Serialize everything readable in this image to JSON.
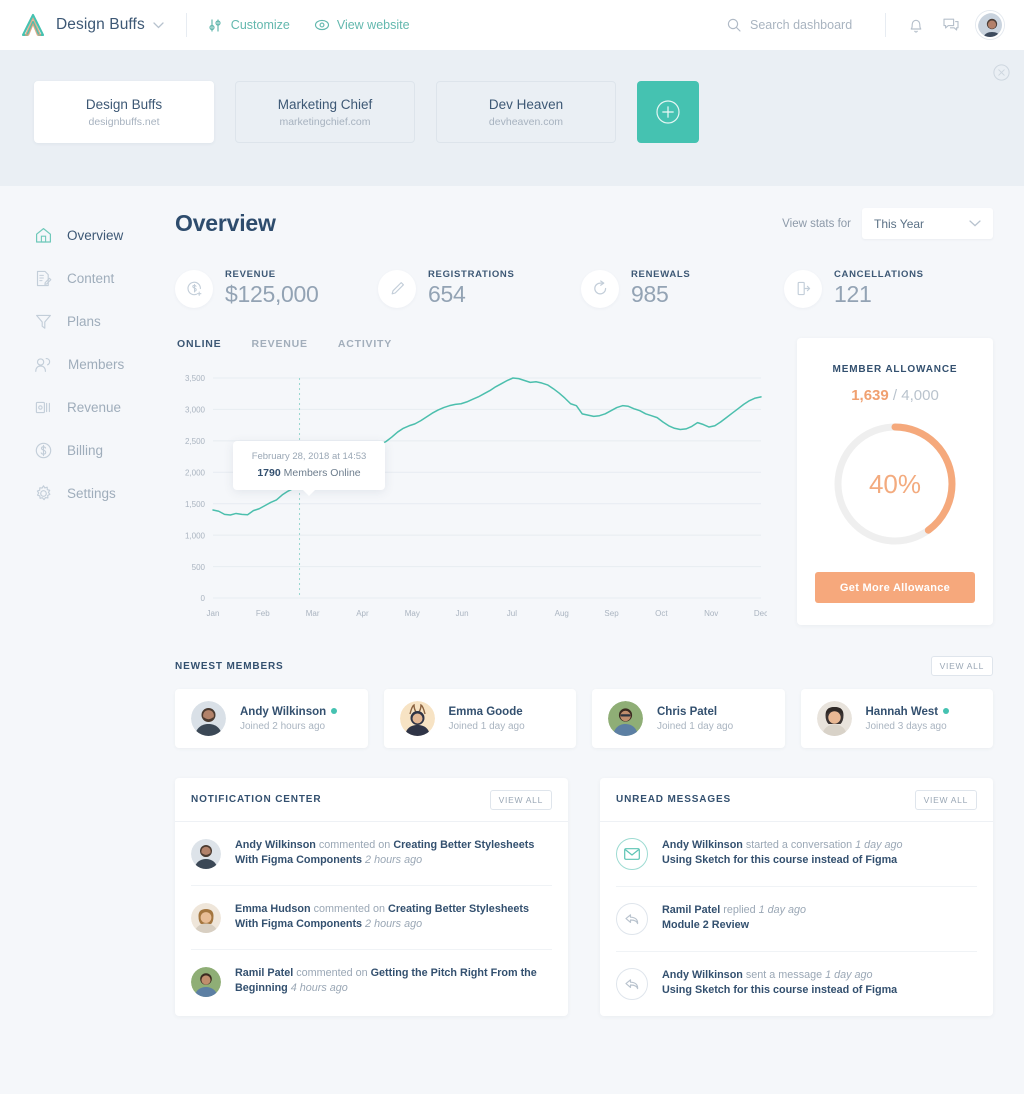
{
  "topbar": {
    "brand": "Design Buffs",
    "logo_icon": "mountain-logo-icon",
    "customize_label": "Customize",
    "customize_icon": "sliders-icon",
    "view_website_label": "View website",
    "view_website_icon": "eye-icon",
    "search_placeholder": "Search dashboard",
    "search_value": "",
    "search_icon": "search-icon",
    "bell_icon": "bell-icon",
    "chat_icon": "chat-icon",
    "avatar_icon": "user-avatar"
  },
  "sites": {
    "close_icon": "close-circle-icon",
    "add_label": "+",
    "items": [
      {
        "name": "Design Buffs",
        "url": "designbuffs.net",
        "active": true
      },
      {
        "name": "Marketing Chief",
        "url": "marketingchief.com",
        "active": false
      },
      {
        "name": "Dev Heaven",
        "url": "devheaven.com",
        "active": false
      }
    ]
  },
  "sidebar": {
    "items": [
      {
        "label": "Overview",
        "icon": "home-icon",
        "active": true
      },
      {
        "label": "Content",
        "icon": "document-edit-icon",
        "active": false
      },
      {
        "label": "Plans",
        "icon": "funnel-icon",
        "active": false
      },
      {
        "label": "Members",
        "icon": "users-icon",
        "active": false
      },
      {
        "label": "Revenue",
        "icon": "banknote-icon",
        "active": false
      },
      {
        "label": "Billing",
        "icon": "dollar-circle-icon",
        "active": false
      },
      {
        "label": "Settings",
        "icon": "gear-icon",
        "active": false
      }
    ]
  },
  "main": {
    "title": "Overview",
    "stats_for_label": "View stats for",
    "stats_period": "This Year",
    "period_options": [
      "This Year"
    ],
    "kpis": [
      {
        "label": "REVENUE",
        "value": "$125,000",
        "icon": "revenue-coin-icon"
      },
      {
        "label": "REGISTRATIONS",
        "value": "654",
        "icon": "pencil-icon"
      },
      {
        "label": "RENEWALS",
        "value": "985",
        "icon": "refresh-icon"
      },
      {
        "label": "CANCELLATIONS",
        "value": "121",
        "icon": "exit-door-icon"
      }
    ],
    "chart_tabs": [
      {
        "label": "ONLINE",
        "active": true
      },
      {
        "label": "REVENUE",
        "active": false
      },
      {
        "label": "ACTIVITY",
        "active": false
      }
    ],
    "tooltip": {
      "date": "February 28, 2018 at 14:53",
      "value": "1790",
      "suffix": " Members Online"
    }
  },
  "chart_data": {
    "type": "line",
    "title": "Members Online",
    "xlabel": "",
    "ylabel": "",
    "ylim": [
      0,
      3500
    ],
    "yticks": [
      0,
      500,
      1000,
      1500,
      2000,
      2500,
      3000,
      3500
    ],
    "ytick_labels": [
      "0",
      "500",
      "1,000",
      "1,500",
      "2,000",
      "2,500",
      "3,000",
      "3,500"
    ],
    "grid": true,
    "legend": "none",
    "line_color": "#4cbfad",
    "categories": [
      "Jan",
      "Feb",
      "Mar",
      "Apr",
      "May",
      "Jun",
      "Jul",
      "Aug",
      "Sep",
      "Oct",
      "Nov",
      "Dec"
    ],
    "highlight": {
      "x_label": "Feb 28",
      "value": 1790
    },
    "series": [
      {
        "name": "Members Online",
        "values": [
          1400,
          1380,
          1330,
          1320,
          1345,
          1330,
          1325,
          1390,
          1420,
          1470,
          1520,
          1560,
          1640,
          1700,
          1745,
          1790,
          1790,
          1770,
          1800,
          1830,
          1900,
          1905,
          1910,
          1915,
          2130,
          2220,
          2290,
          2380,
          2420,
          2440,
          2490,
          2560,
          2640,
          2700,
          2740,
          2770,
          2820,
          2880,
          2940,
          2990,
          3030,
          3060,
          3080,
          3090,
          3120,
          3160,
          3200,
          3250,
          3300,
          3360,
          3410,
          3460,
          3500,
          3490,
          3460,
          3430,
          3440,
          3420,
          3390,
          3330,
          3260,
          3180,
          3090,
          3060,
          2930,
          2910,
          2890,
          2900,
          2930,
          2980,
          3030,
          3060,
          3050,
          3010,
          2980,
          2930,
          2900,
          2870,
          2800,
          2740,
          2700,
          2680,
          2690,
          2730,
          2790,
          2760,
          2720,
          2740,
          2800,
          2870,
          2940,
          3010,
          3080,
          3140,
          3180,
          3200
        ]
      }
    ]
  },
  "allowance": {
    "title": "MEMBER ALLOWANCE",
    "used": "1,639",
    "separator": " / ",
    "total": "4,000",
    "percent_label": "40%",
    "percent": 40,
    "button_label": "Get More Allowance",
    "accent_color": "#f5a97c",
    "track_color": "#efefef"
  },
  "newest_members": {
    "title": "NEWEST MEMBERS",
    "view_all": "VIEW ALL",
    "items": [
      {
        "name": "Andy Wilkinson",
        "joined": "Joined 2 hours ago",
        "online": true,
        "avatar": "avatar-andy"
      },
      {
        "name": "Emma Goode",
        "joined": "Joined 1 day ago",
        "online": false,
        "avatar": "avatar-emma"
      },
      {
        "name": "Chris Patel",
        "joined": "Joined 1 day ago",
        "online": false,
        "avatar": "avatar-chris"
      },
      {
        "name": "Hannah West",
        "joined": "Joined 3 days ago",
        "online": true,
        "avatar": "avatar-hannah"
      }
    ]
  },
  "notification_center": {
    "title": "NOTIFICATION CENTER",
    "view_all": "VIEW ALL",
    "items": [
      {
        "actor": "Andy Wilkinson",
        "action": " commented on ",
        "subject": "Creating Better Stylesheets With Figma Components",
        "time": " 2 hours ago",
        "avatar": "avatar-andy"
      },
      {
        "actor": "Emma Hudson",
        "action": " commented on ",
        "subject": "Creating Better Stylesheets With Figma Components",
        "time": " 2 hours ago",
        "avatar": "avatar-emma-h"
      },
      {
        "actor": "Ramil Patel",
        "action": " commented on ",
        "subject": "Getting the Pitch Right From the Beginning",
        "time": " 4 hours ago",
        "avatar": "avatar-ramil"
      }
    ]
  },
  "unread_messages": {
    "title": "UNREAD MESSAGES",
    "view_all": "VIEW ALL",
    "items": [
      {
        "actor": "Andy Wilkinson",
        "action": " started a conversation ",
        "time": "1 day ago",
        "subject": "Using Sketch for this course instead of Figma",
        "icon": "envelope-icon",
        "icon_style": "teal"
      },
      {
        "actor": "Ramil Patel",
        "action": " replied ",
        "time": "1 day ago",
        "subject": "Module 2 Review",
        "icon": "reply-arrow-icon",
        "icon_style": "gray"
      },
      {
        "actor": "Andy Wilkinson",
        "action": " sent a message ",
        "time": "1 day ago",
        "subject": "Using Sketch for this course instead of Figma",
        "icon": "reply-arrow-icon",
        "icon_style": "gray"
      }
    ]
  }
}
